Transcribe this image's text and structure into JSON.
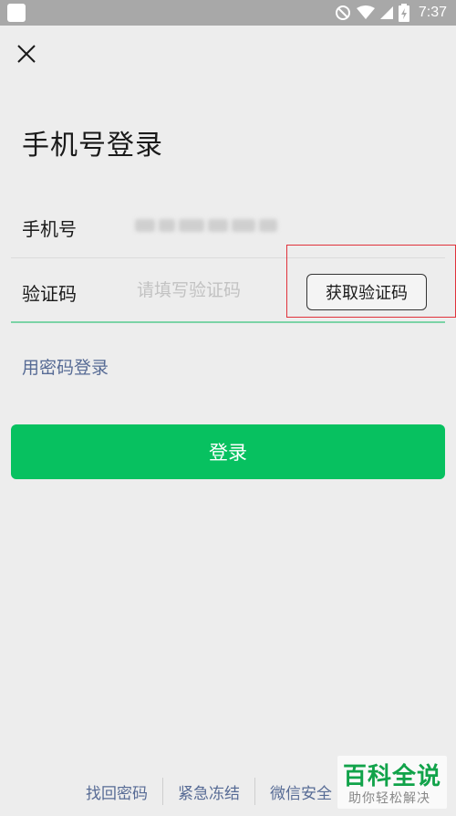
{
  "status_bar": {
    "time": "7:37",
    "icons": [
      "blank-app-icon",
      "do-not-disturb-icon",
      "wifi-icon",
      "signal-icon",
      "battery-icon"
    ],
    "colors": {
      "background": "#a8a8a8",
      "foreground": "#ffffff"
    }
  },
  "header": {
    "close_icon": "close-icon",
    "title": "手机号登录"
  },
  "form": {
    "phone": {
      "label": "手机号",
      "value_state": "blurred"
    },
    "code": {
      "label": "验证码",
      "placeholder": "请填写验证码",
      "value": "",
      "get_code_label": "获取验证码"
    }
  },
  "links": {
    "alt_login": "用密码登录"
  },
  "login_button": {
    "label": "登录",
    "color": "#07c160"
  },
  "footer": {
    "links": [
      "找回密码",
      "紧急冻结",
      "微信安全"
    ]
  },
  "watermark": {
    "main": "百科全说",
    "sub": "助你轻松解决"
  },
  "colors": {
    "page_bg": "#ededed",
    "link": "#576b95",
    "highlight": "#e0323b",
    "input_focus_line": "#7bd3a6"
  }
}
